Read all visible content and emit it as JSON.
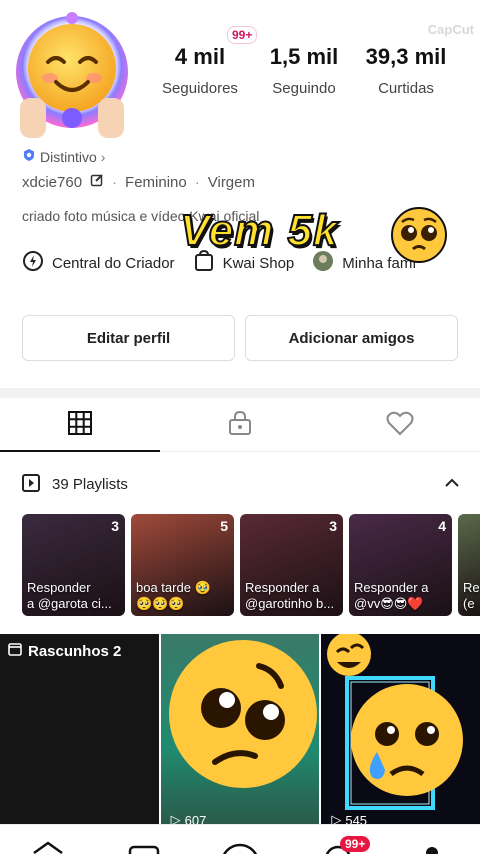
{
  "profile": {
    "stats": [
      {
        "value": "4 mil",
        "label": "Seguidores"
      },
      {
        "value": "1,5 mil",
        "label": "Seguindo"
      },
      {
        "value": "39,3 mil",
        "label": "Curtidas"
      }
    ],
    "notification_badge": "99+",
    "watermark": "CapCut",
    "verified_label": "Distintivo",
    "username": "xdcie760",
    "gender": "Feminino",
    "sign": "Virgem",
    "bio": "criado foto música e vídeo Kwai oficial",
    "links": [
      {
        "icon": "creator-center-icon",
        "label": "Central do Criador"
      },
      {
        "icon": "kwai-shop-icon",
        "label": "Kwai Shop"
      },
      {
        "icon": "family-avatar",
        "label": "Minha famí"
      }
    ],
    "overlay_text": "Vem 5k",
    "buttons": {
      "edit": "Editar perfil",
      "add_friends": "Adicionar amigos"
    }
  },
  "tabs": [
    {
      "icon": "grid-icon",
      "active": true
    },
    {
      "icon": "lock-icon",
      "active": false
    },
    {
      "icon": "heart-icon",
      "active": false
    }
  ],
  "playlists": {
    "header": "39 Playlists",
    "items": [
      {
        "count": "3",
        "caption": "Responder\na @garota ci...",
        "color": "#3a2a3e"
      },
      {
        "count": "5",
        "caption": "boa tarde 🥹\n🥺🥺🥺",
        "color": "#a04a3a"
      },
      {
        "count": "3",
        "caption": "Responder a\n@garotinho b...",
        "color": "#5a2a35"
      },
      {
        "count": "4",
        "caption": "Responder a\n@vv😎😎❤️",
        "color": "#4a2a48"
      },
      {
        "count": "",
        "caption": "Re\n(e",
        "color": "#5a6a4a"
      }
    ]
  },
  "grid": {
    "drafts_label": "Rascunhos 2",
    "views": [
      "607",
      "545"
    ]
  },
  "bottom_nav": {
    "badge": "99+"
  }
}
